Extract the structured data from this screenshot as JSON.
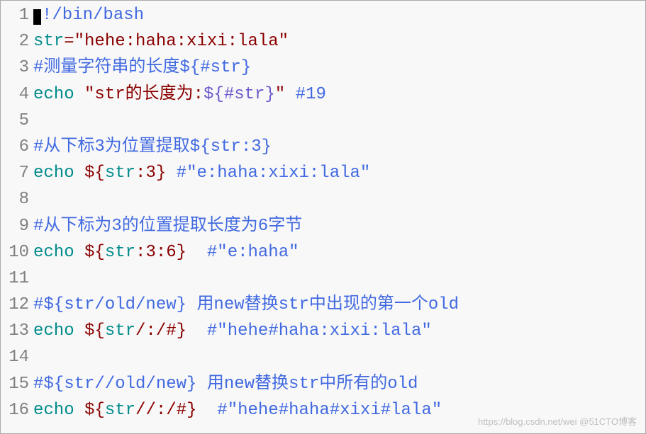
{
  "lines": [
    {
      "num": "1",
      "tokens": [
        {
          "cls": "cursor",
          "t": ""
        },
        {
          "cls": "tok-comment",
          "t": "!/bin/bash"
        }
      ]
    },
    {
      "num": "2",
      "tokens": [
        {
          "cls": "tok-var",
          "t": "str"
        },
        {
          "cls": "tok-op",
          "t": "="
        },
        {
          "cls": "tok-string",
          "t": "\"hehe:haha:xixi:lala\""
        }
      ]
    },
    {
      "num": "3",
      "tokens": [
        {
          "cls": "tok-comment",
          "t": "#测量字符串的长度${#str}"
        }
      ]
    },
    {
      "num": "4",
      "tokens": [
        {
          "cls": "tok-keyword",
          "t": "echo"
        },
        {
          "cls": "",
          "t": " "
        },
        {
          "cls": "tok-string",
          "t": "\"str的长度为:"
        },
        {
          "cls": "tok-purple",
          "t": "${#str}"
        },
        {
          "cls": "tok-string",
          "t": "\""
        },
        {
          "cls": "",
          "t": " "
        },
        {
          "cls": "tok-comment",
          "t": "#19"
        }
      ]
    },
    {
      "num": "5",
      "tokens": []
    },
    {
      "num": "6",
      "tokens": [
        {
          "cls": "tok-comment",
          "t": "#从下标3为位置提取${str:3}"
        }
      ]
    },
    {
      "num": "7",
      "tokens": [
        {
          "cls": "tok-keyword",
          "t": "echo"
        },
        {
          "cls": "",
          "t": " "
        },
        {
          "cls": "tok-darkred",
          "t": "${"
        },
        {
          "cls": "tok-var",
          "t": "str"
        },
        {
          "cls": "tok-darkred",
          "t": ":"
        },
        {
          "cls": "tok-number",
          "t": "3"
        },
        {
          "cls": "tok-darkred",
          "t": "}"
        },
        {
          "cls": "",
          "t": " "
        },
        {
          "cls": "tok-comment",
          "t": "#\"e:haha:xixi:lala\""
        }
      ]
    },
    {
      "num": "8",
      "tokens": []
    },
    {
      "num": "9",
      "tokens": [
        {
          "cls": "tok-comment",
          "t": "#从下标为3的位置提取长度为6字节"
        }
      ]
    },
    {
      "num": "10",
      "tokens": [
        {
          "cls": "tok-keyword",
          "t": "echo"
        },
        {
          "cls": "",
          "t": " "
        },
        {
          "cls": "tok-darkred",
          "t": "${"
        },
        {
          "cls": "tok-var",
          "t": "str"
        },
        {
          "cls": "tok-darkred",
          "t": ":"
        },
        {
          "cls": "tok-number",
          "t": "3"
        },
        {
          "cls": "tok-darkred",
          "t": ":"
        },
        {
          "cls": "tok-number",
          "t": "6"
        },
        {
          "cls": "tok-darkred",
          "t": "}"
        },
        {
          "cls": "",
          "t": "  "
        },
        {
          "cls": "tok-comment",
          "t": "#\"e:haha\""
        }
      ]
    },
    {
      "num": "11",
      "tokens": []
    },
    {
      "num": "12",
      "tokens": [
        {
          "cls": "tok-comment",
          "t": "#${str/old/new} 用new替换str中出现的第一个old"
        }
      ]
    },
    {
      "num": "13",
      "tokens": [
        {
          "cls": "tok-keyword",
          "t": "echo"
        },
        {
          "cls": "",
          "t": " "
        },
        {
          "cls": "tok-darkred",
          "t": "${"
        },
        {
          "cls": "tok-var",
          "t": "str"
        },
        {
          "cls": "tok-darkred",
          "t": "/"
        },
        {
          "cls": "tok-darkred",
          "t": ":"
        },
        {
          "cls": "tok-darkred",
          "t": "/#}"
        },
        {
          "cls": "",
          "t": "  "
        },
        {
          "cls": "tok-comment",
          "t": "#\"hehe#haha:xixi:lala\""
        }
      ]
    },
    {
      "num": "14",
      "tokens": []
    },
    {
      "num": "15",
      "tokens": [
        {
          "cls": "tok-comment",
          "t": "#${str//old/new} 用new替换str中所有的old"
        }
      ]
    },
    {
      "num": "16",
      "tokens": [
        {
          "cls": "tok-keyword",
          "t": "echo"
        },
        {
          "cls": "",
          "t": " "
        },
        {
          "cls": "tok-darkred",
          "t": "${"
        },
        {
          "cls": "tok-var",
          "t": "str"
        },
        {
          "cls": "tok-darkred",
          "t": "//"
        },
        {
          "cls": "tok-darkred",
          "t": ":"
        },
        {
          "cls": "tok-darkred",
          "t": "/#}"
        },
        {
          "cls": "",
          "t": "  "
        },
        {
          "cls": "tok-comment",
          "t": "#\"hehe#haha#xixi#lala\""
        }
      ]
    }
  ],
  "watermark": "https://blog.csdn.net/wei @51CTO博客"
}
